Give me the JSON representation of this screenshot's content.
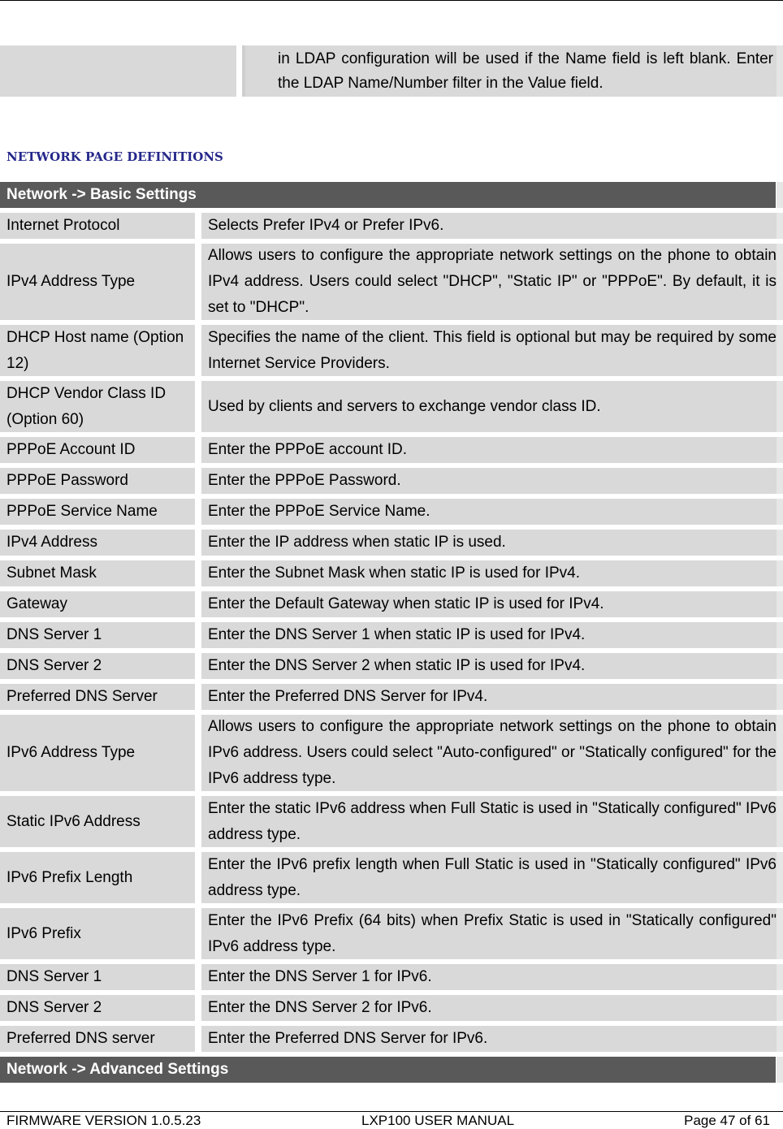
{
  "continuation": {
    "text": "in LDAP configuration will be used if the Name field is left blank. Enter the LDAP Name/Number filter in the Value field."
  },
  "section_heading": "NETWORK PAGE DEFINITIONS",
  "basic": {
    "header": "Network -> Basic Settings",
    "rows": [
      {
        "name": "Internet Protocol",
        "desc": "Selects Prefer IPv4 or Prefer IPv6."
      },
      {
        "name": "IPv4 Address Type",
        "desc": "Allows users to configure the appropriate network settings on the phone to obtain IPv4 address. Users could select \"DHCP\", \"Static IP\" or \"PPPoE\". By default, it is set to \"DHCP\"."
      },
      {
        "name": "DHCP Host name (Option 12)",
        "desc": "Specifies the name of the client. This field is optional but may be required by some Internet Service Providers."
      },
      {
        "name": "DHCP Vendor Class ID (Option 60)",
        "desc": "Used by clients and servers to exchange vendor class ID."
      },
      {
        "name": "PPPoE Account ID",
        "desc": "Enter the PPPoE account ID."
      },
      {
        "name": "PPPoE Password",
        "desc": "Enter the PPPoE Password."
      },
      {
        "name": "PPPoE Service Name",
        "desc": "Enter the PPPoE Service Name."
      },
      {
        "name": "IPv4 Address",
        "desc": "Enter the IP address when static IP is used."
      },
      {
        "name": "Subnet Mask",
        "desc": "Enter the Subnet Mask when static IP is used for IPv4."
      },
      {
        "name": "Gateway",
        "desc": "Enter the Default Gateway when static IP is used for IPv4."
      },
      {
        "name": "DNS Server 1",
        "desc": "Enter the DNS Server 1 when static IP is used for IPv4."
      },
      {
        "name": "DNS Server 2",
        "desc": "Enter the DNS Server 2 when static IP is used for IPv4."
      },
      {
        "name": "Preferred DNS Server",
        "desc": "Enter the Preferred DNS Server for IPv4."
      },
      {
        "name": "IPv6 Address Type",
        "desc": "Allows users to configure the appropriate network settings on the phone to obtain IPv6 address. Users could select \"Auto-configured\" or \"Statically configured\" for the IPv6 address type."
      },
      {
        "name": "Static IPv6 Address",
        "desc": "Enter the static IPv6 address when Full Static is used in \"Statically configured\" IPv6 address type."
      },
      {
        "name": "IPv6 Prefix Length",
        "desc": "Enter the IPv6 prefix length when Full Static is used in \"Statically configured\" IPv6 address type."
      },
      {
        "name": "IPv6 Prefix",
        "desc": "Enter the IPv6 Prefix (64 bits) when Prefix Static is used in \"Statically configured\" IPv6 address type."
      },
      {
        "name": "DNS Server 1",
        "desc": "Enter the DNS Server 1 for IPv6."
      },
      {
        "name": "DNS Server 2",
        "desc": "Enter the DNS Server 2 for IPv6."
      },
      {
        "name": "Preferred DNS server",
        "desc": "Enter the Preferred DNS Server for IPv6."
      }
    ]
  },
  "advanced": {
    "header": "Network -> Advanced Settings"
  },
  "footer": {
    "firmware": "FIRMWARE VERSION 1.0.5.23",
    "manual": "LXP100 USER MANUAL",
    "page": "Page 47 of 61"
  }
}
